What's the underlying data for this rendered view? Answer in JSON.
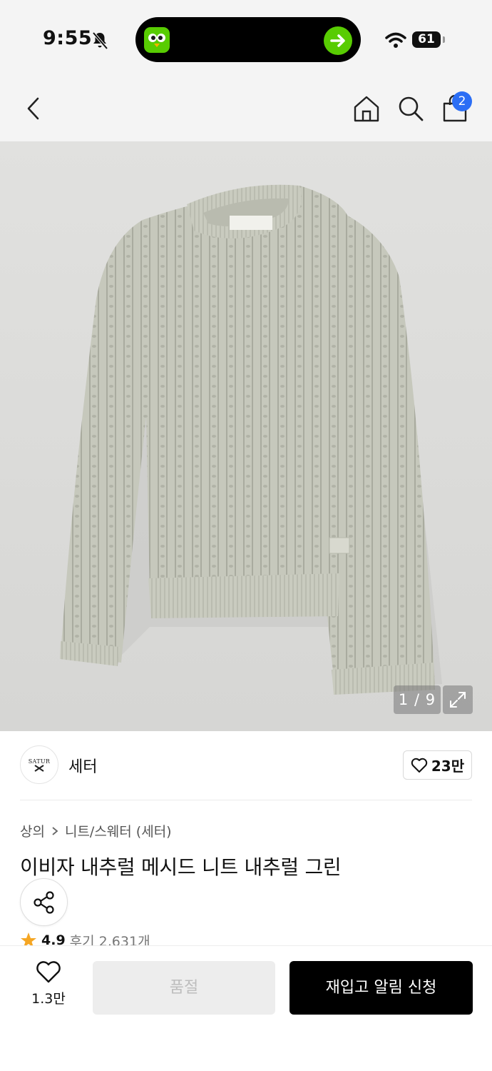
{
  "status_bar": {
    "time": "9:55",
    "battery": "61",
    "icons": [
      "bell-slash-icon",
      "duolingo-app-icon",
      "arrow-right-icon",
      "wifi-icon",
      "battery-icon"
    ]
  },
  "nav": {
    "icons": [
      "chevron-left-icon",
      "home-icon",
      "search-icon",
      "shopping-bag-icon"
    ],
    "cart_badge": "2"
  },
  "gallery": {
    "counter": "1 / 9",
    "icons": [
      "expand-icon"
    ]
  },
  "brand": {
    "logo_text": "SATUR",
    "name": "세터",
    "like_count": "23만",
    "icons": [
      "heart-outline-icon"
    ]
  },
  "breadcrumb": {
    "category": "상의",
    "subcategory": "니트/스웨터 (세터)"
  },
  "product": {
    "title": "이비자 내추럴 메시드 니트 내추럴 그린",
    "rating": "4.9",
    "reviews": "후기 2,631개",
    "icons": [
      "share-icon",
      "star-icon"
    ]
  },
  "bottom": {
    "wish_count": "1.3만",
    "soldout_label": "품절",
    "restock_label": "재입고 알림 신청"
  },
  "colors": {
    "accent_badge": "#2b6ef5",
    "star": "#f5a623",
    "cta": "#000000",
    "duolingo_green": "#58cc02",
    "sweater": "#c9cbbf"
  }
}
